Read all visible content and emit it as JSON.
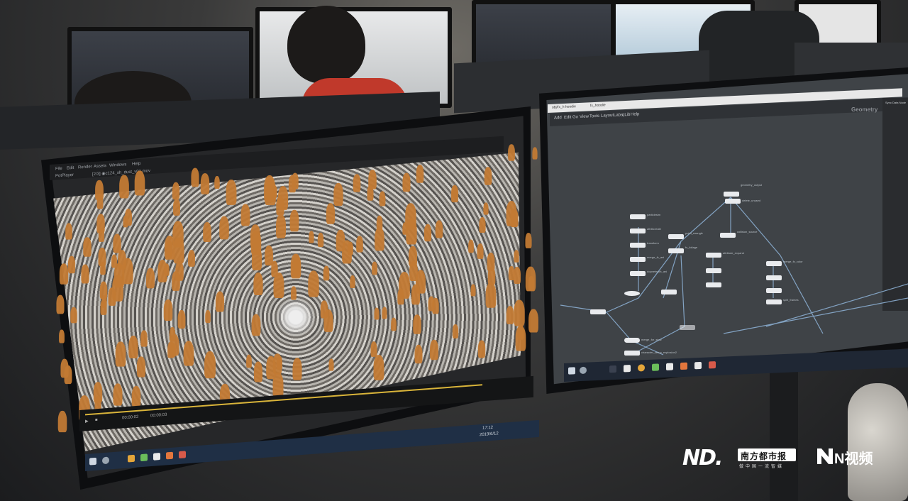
{
  "scene": {
    "description_tags": [
      "office",
      "dual-monitors",
      "vfx-crowd-simulation",
      "node-graph"
    ]
  },
  "left_monitor": {
    "menu_items": [
      "File",
      "Edit",
      "Render",
      "Assets",
      "Windows",
      "Help"
    ],
    "toolbar_labels": {
      "player": "PotPlayer",
      "filename": "[2/3] ◉c124_sh_dust_v01.mov"
    },
    "timecode": "00:00:02",
    "frame_total": "00:00:03",
    "taskbar_time": "17:12",
    "taskbar_date": "2019/6/12"
  },
  "right_monitor": {
    "window_title": "obj/fx_h hoodie",
    "tab_label": "fx_hoodie",
    "menu_items": [
      "Add",
      "Edit",
      "Go",
      "View",
      "Tools",
      "Layout",
      "Labs",
      "qLib",
      "Help"
    ],
    "context_label": "Geometry",
    "panel_title": "Sync Data Node",
    "nodes": [
      {
        "label": "geometry_output"
      },
      {
        "label": "delete_unused"
      },
      {
        "label": "particlesim"
      },
      {
        "label": "attribcreate"
      },
      {
        "label": "transform"
      },
      {
        "label": "merge_fx_ani"
      },
      {
        "label": "dopnetwork_ani"
      },
      {
        "label": "point_wrangle"
      },
      {
        "label": "fx_foliage"
      },
      {
        "label": "collision_source"
      },
      {
        "label": "attribute_expand"
      },
      {
        "label": "merge_fx_color"
      },
      {
        "label": "merge_for_sim2"
      },
      {
        "label": "character_setup_explosion2"
      },
      {
        "label": "split_frames"
      }
    ]
  },
  "watermark": {
    "nd_logo": "ND.",
    "nandu_text": "南方都市报",
    "nandu_sub": "做中国一流智媒",
    "n_video_text": "N视频"
  },
  "colors": {
    "crowd_orange": "#c27a34",
    "timeline_yellow": "#d9b43a",
    "node_white": "#e9ebee",
    "wire_blue": "#8fb4d9"
  }
}
